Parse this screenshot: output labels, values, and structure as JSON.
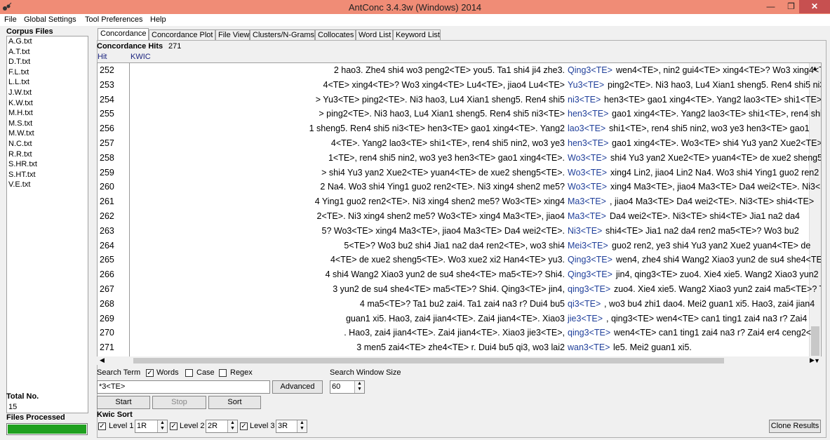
{
  "window": {
    "title": "AntConc 3.4.3w (Windows) 2014"
  },
  "menu": [
    "File",
    "Global Settings",
    "Tool Preferences",
    "Help"
  ],
  "corpus": {
    "label": "Corpus Files",
    "files": [
      "A.G.txt",
      "A.T.txt",
      "D.T.txt",
      "F.L.txt",
      "L.L.txt",
      "J.W.txt",
      "K.W.txt",
      "M.H.txt",
      "M.S.txt",
      "M.W.txt",
      "N.C.txt",
      "R.R.txt",
      "S.HR.txt",
      "S.HT.txt",
      "V.E.txt"
    ],
    "total_label": "Total No.",
    "total_value": "15",
    "processed_label": "Files Processed",
    "progress": 1.0
  },
  "tabs": [
    "Concordance",
    "Concordance Plot",
    "File View",
    "Clusters/N-Grams",
    "Collocates",
    "Word List",
    "Keyword List"
  ],
  "concordance": {
    "hits_label": "Concordance Hits",
    "hits_value": "271",
    "col_hit": "Hit",
    "col_kwic": "KWIC",
    "rows": [
      {
        "hit": "252",
        "left": "2 hao3. Zhe4 shi4 wo3 peng2<TE> you5. Ta1 shi4 ji4 zhe3.",
        "kw": "Qing3<TE>",
        "right": "wen4<TE>, nin2 gui4<TE> xing4<TE>? Wo3 xing4<TE>"
      },
      {
        "hit": "253",
        "left": "4<TE> xing4<TE>? Wo3 xing4<TE> Lu4<TE>, jiao4 Lu4<TE>",
        "kw": "Yu3<TE>",
        "right": "ping2<TE>. Ni3 hao3, Lu4 Xian1 sheng5. Ren4 shi5 ni3"
      },
      {
        "hit": "254",
        "left": "> Yu3<TE> ping2<TE>. Ni3 hao3, Lu4 Xian1 sheng5. Ren4 shi5",
        "kw": "ni3<TE>",
        "right": "hen3<TE> gao1 xing4<TE>. Yang2 lao3<TE> shi1<TE>,"
      },
      {
        "hit": "255",
        "left": "> ping2<TE>. Ni3 hao3, Lu4 Xian1 sheng5. Ren4 shi5 ni3<TE>",
        "kw": "hen3<TE>",
        "right": "gao1 xing4<TE>. Yang2 lao3<TE> shi1<TE>, ren4 shi5"
      },
      {
        "hit": "256",
        "left": "1 sheng5. Ren4 shi5 ni3<TE> hen3<TE> gao1 xing4<TE>. Yang2",
        "kw": "lao3<TE>",
        "right": "shi1<TE>, ren4 shi5 nin2, wo3 ye3 hen3<TE> gao1"
      },
      {
        "hit": "257",
        "left": "4<TE>. Yang2 lao3<TE> shi1<TE>, ren4 shi5 nin2, wo3 ye3",
        "kw": "hen3<TE>",
        "right": "gao1 xing4<TE>.     Wo3<TE> shi4 Yu3 yan2 Xue2<TE>"
      },
      {
        "hit": "258",
        "left": "1<TE>, ren4 shi5 nin2, wo3 ye3 hen3<TE> gao1 xing4<TE>.",
        "kw": "Wo3<TE>",
        "right": "shi4 Yu3 yan2 Xue2<TE> yuan4<TE> de xue2 sheng5<"
      },
      {
        "hit": "259",
        "left": "> shi4 Yu3 yan2 Xue2<TE> yuan4<TE> de xue2 sheng5<TE>.",
        "kw": "Wo3<TE>",
        "right": "xing4 Lin2, jiao4 Lin2 Na4. Wo3 shi4 Ying1 guo2 ren2"
      },
      {
        "hit": "260",
        "left": "2 Na4. Wo3 shi4 Ying1 guo2 ren2<TE>. Ni3 xing4 shen2 me5?",
        "kw": "Wo3<TE>",
        "right": "xing4 Ma3<TE>, jiao4 Ma3<TE> Da4 wei2<TE>. Ni3<"
      },
      {
        "hit": "261",
        "left": "4 Ying1 guo2 ren2<TE>. Ni3 xing4 shen2 me5? Wo3<TE> xing4",
        "kw": "Ma3<TE>",
        "right": ", jiao4 Ma3<TE> Da4 wei2<TE>. Ni3<TE> shi4<TE>"
      },
      {
        "hit": "262",
        "left": "2<TE>. Ni3 xing4 shen2 me5? Wo3<TE> xing4 Ma3<TE>, jiao4",
        "kw": "Ma3<TE>",
        "right": "Da4 wei2<TE>. Ni3<TE> shi4<TE> Jia1 na2 da4"
      },
      {
        "hit": "263",
        "left": "5? Wo3<TE> xing4 Ma3<TE>, jiao4 Ma3<TE> Da4 wei2<TE>.",
        "kw": "Ni3<TE>",
        "right": "shi4<TE> Jia1 na2 da4 ren2 ma5<TE>? Wo3 bu2"
      },
      {
        "hit": "264",
        "left": "5<TE>? Wo3 bu2 shi4 Jia1 na2 da4 ren2<TE>, wo3 shi4",
        "kw": "Mei3<TE>",
        "right": "guo2 ren2, ye3 shi4 Yu3 yan2 Xue2 yuan4<TE> de"
      },
      {
        "hit": "265",
        "left": "4<TE> de xue2 sheng5<TE>. Wo3 xue2 xi2 Han4<TE> yu3.",
        "kw": "Qing3<TE>",
        "right": "wen4, zhe4 shi4 Wang2 Xiao3 yun2 de su4 she4<TE>"
      },
      {
        "hit": "266",
        "left": "4 shi4 Wang2 Xiao3 yun2 de su4 she4<TE> ma5<TE>?  Shi4.",
        "kw": "Qing3<TE>",
        "right": "jin4, qing3<TE> zuo4. Xie4 xie5. Wang2 Xiao3 yun2"
      },
      {
        "hit": "267",
        "left": "3 yun2 de su4 she4<TE> ma5<TE>?  Shi4. Qing3<TE> jin4,",
        "kw": "qing3<TE>",
        "right": "zuo4. Xie4 xie5. Wang2 Xiao3 yun2 zai4 ma5<TE>? Ta"
      },
      {
        "hit": "268",
        "left": "4 ma5<TE>? Ta1 bu2 zai4. Ta1 zai4 na3 r? Dui4 bu5",
        "kw": "qi3<TE>",
        "right": ", wo3 bu4 zhi1 dao4. Mei2 guan1 xi5. Hao3, zai4 jian4"
      },
      {
        "hit": "269",
        "left": "guan1 xi5. Hao3, zai4 jian4<TE>. Zai4 jian4<TE>.     Xiao3",
        "kw": "jie3<TE>",
        "right": ", qing3<TE> wen4<TE> can1 ting1 zai4 na3 r? Zai4"
      },
      {
        "hit": "270",
        "left": ". Hao3, zai4 jian4<TE>. Zai4 jian4<TE>.     Xiao3 jie3<TE>,",
        "kw": "qing3<TE>",
        "right": "wen4<TE> can1 ting1 zai4 na3 r? Zai4 er4 ceng2<"
      },
      {
        "hit": "271",
        "left": "3 men5 zai4<TE> zhe4<TE> r. Dui4 bu5 qi3, wo3 lai2",
        "kw": "wan3<TE>",
        "right": "le5. Mei2 guan1 xi5."
      }
    ]
  },
  "search": {
    "term_label": "Search Term",
    "words_label": "Words",
    "case_label": "Case",
    "regex_label": "Regex",
    "term_value": "*3<TE>",
    "advanced_label": "Advanced",
    "window_size_label": "Search Window Size",
    "window_size_value": "60",
    "start_label": "Start",
    "stop_label": "Stop",
    "sort_label": "Sort"
  },
  "kwic_sort": {
    "label": "Kwic Sort",
    "level1_label": "Level 1",
    "level1_value": "1R",
    "level2_label": "Level 2",
    "level2_value": "2R",
    "level3_label": "Level 3",
    "level3_value": "3R"
  },
  "clone_label": "Clone Results"
}
